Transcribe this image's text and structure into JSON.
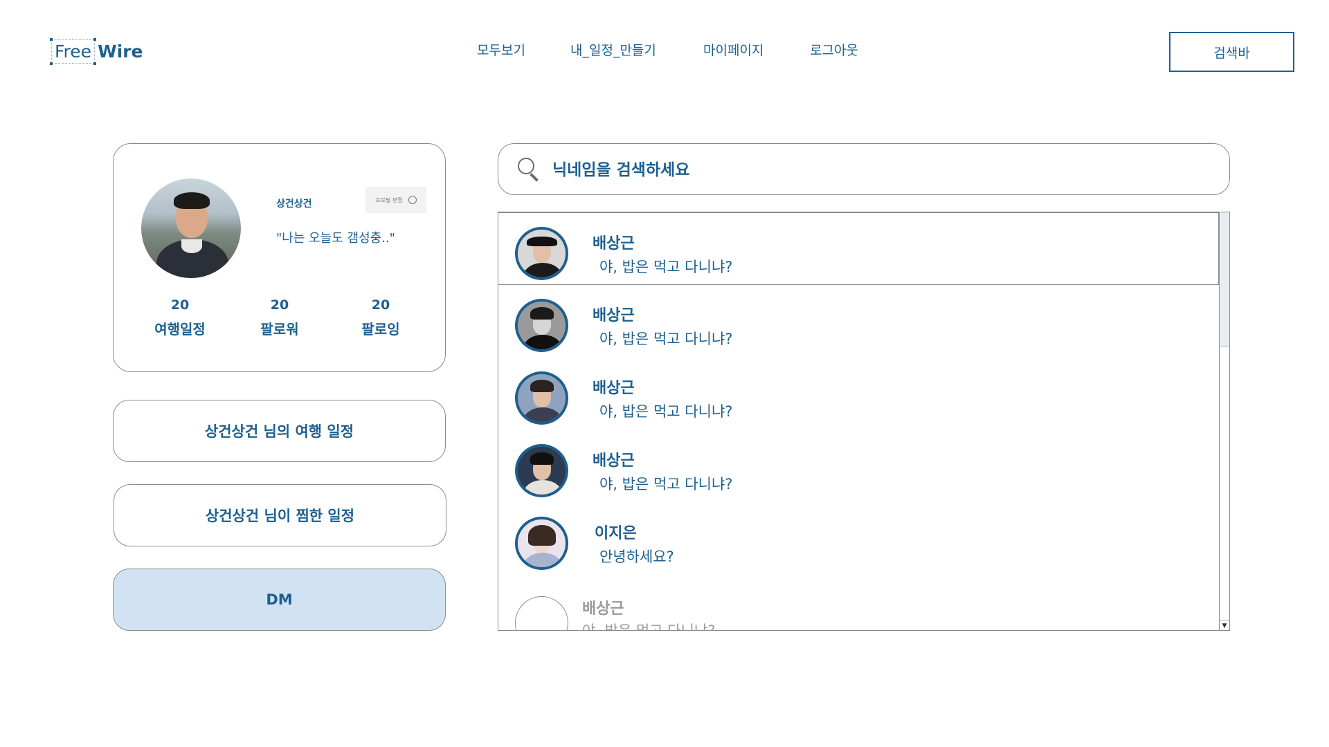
{
  "logo": {
    "free": "Free",
    "wire": "Wire"
  },
  "nav": [
    {
      "label": "모두보기"
    },
    {
      "label": "내_일정_만들기"
    },
    {
      "label": "마이페이지"
    },
    {
      "label": "로그아웃"
    }
  ],
  "header": {
    "search_button": "검색바"
  },
  "profile": {
    "username": "상건상건",
    "edit_label": "프로필 편집",
    "status": "\"나는 오늘도 갬성충..\"",
    "stats": [
      {
        "count": "20",
        "label": "여행일정"
      },
      {
        "count": "20",
        "label": "팔로워"
      },
      {
        "count": "20",
        "label": "팔로잉"
      }
    ]
  },
  "side_buttons": {
    "trips": "상건상건 님의 여행 일정",
    "liked": "상건상건 님이 찜한 일정",
    "dm": "DM"
  },
  "search": {
    "placeholder": "닉네임을 검색하세요"
  },
  "dm_list": [
    {
      "name": "배상근",
      "message": "야, 밥은 먹고 다니냐?"
    },
    {
      "name": "배상근",
      "message": "야, 밥은 먹고 다니냐?"
    },
    {
      "name": "배상근",
      "message": "야, 밥은 먹고 다니냐?"
    },
    {
      "name": "배상근",
      "message": "야, 밥은 먹고 다니냐?"
    },
    {
      "name": "이지은",
      "message": "안녕하세요?"
    },
    {
      "name": "배상근",
      "message": "야, 밥은 먹고 다니냐?"
    }
  ],
  "colors": {
    "accent": "#1d5f8e",
    "active_bg": "#d1e3f3",
    "border": "#8a8a8a"
  },
  "scrollbar": {
    "down_arrow": "▼"
  }
}
